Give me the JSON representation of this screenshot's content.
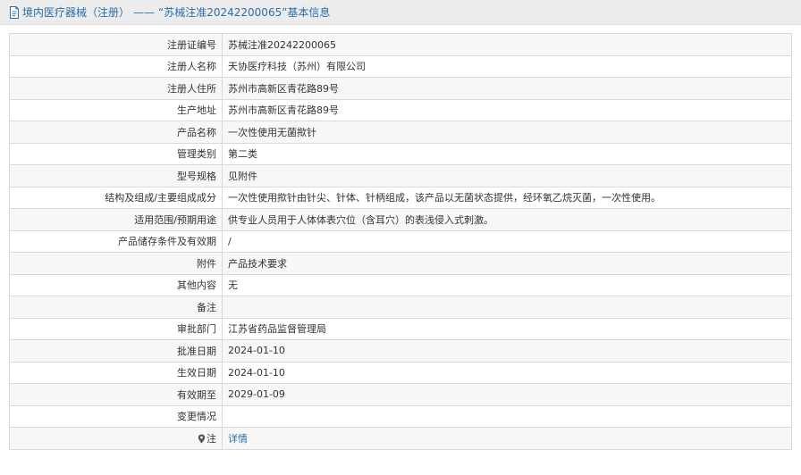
{
  "header": {
    "icon": "document-icon",
    "category": "境内医疗器械（注册）",
    "dash": "——",
    "subject": "“苏械注准20242200065”基本信息"
  },
  "rows": [
    {
      "label": "注册证编号",
      "value": "苏械注准20242200065"
    },
    {
      "label": "注册人名称",
      "value": "天协医疗科技（苏州）有限公司"
    },
    {
      "label": "注册人住所",
      "value": "苏州市高新区青花路89号"
    },
    {
      "label": "生产地址",
      "value": "苏州市高新区青花路89号"
    },
    {
      "label": "产品名称",
      "value": "一次性使用无菌揿针"
    },
    {
      "label": "管理类别",
      "value": "第二类"
    },
    {
      "label": "型号规格",
      "value": "见附件"
    },
    {
      "label": "结构及组成/主要组成成分",
      "value": "一次性使用揿针由针尖、针体、针柄组成，该产品以无菌状态提供，经环氧乙烷灭菌，一次性使用。"
    },
    {
      "label": "适用范围/预期用途",
      "value": "供专业人员用于人体体表穴位（含耳穴）的表浅侵入式刺激。"
    },
    {
      "label": "产品储存条件及有效期",
      "value": "/"
    },
    {
      "label": "附件",
      "value": "产品技术要求"
    },
    {
      "label": "其他内容",
      "value": "无"
    },
    {
      "label": "备注",
      "value": ""
    },
    {
      "label": "审批部门",
      "value": "江苏省药品监督管理局"
    },
    {
      "label": "批准日期",
      "value": "2024-01-10"
    },
    {
      "label": "生效日期",
      "value": "2024-01-10"
    },
    {
      "label": "有效期至",
      "value": "2029-01-09"
    },
    {
      "label": "变更情况",
      "value": ""
    }
  ],
  "note_row": {
    "icon": "location-pin-icon",
    "label": "注",
    "link_text": "详情"
  },
  "colors": {
    "link": "#2b6ea8",
    "header_bg": "#ececec",
    "row_alt_bg": "#f7f7f7",
    "border": "#d9d9d9"
  }
}
